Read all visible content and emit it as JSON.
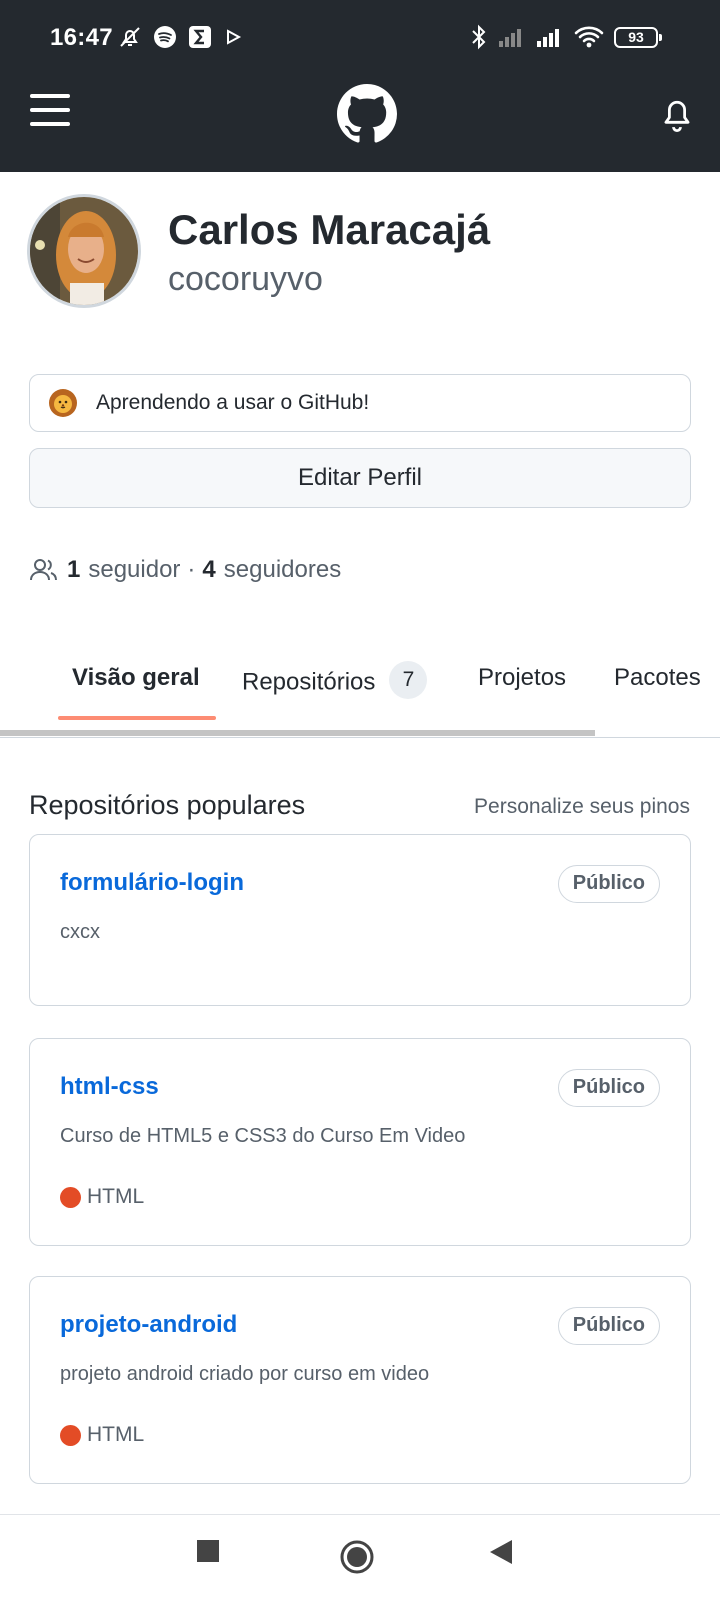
{
  "status_bar": {
    "time": "16:47",
    "battery": "93",
    "left_icons": [
      "mute-bell-icon",
      "spotify-icon",
      "sigma-app-icon",
      "play-store-icon"
    ],
    "right_icons": [
      "bluetooth-icon",
      "signal-icon",
      "signal-icon",
      "wifi-icon",
      "battery-icon"
    ]
  },
  "header": {
    "icons": [
      "menu-icon",
      "github-logo-icon",
      "bell-icon"
    ],
    "background": "#24292f"
  },
  "profile": {
    "display_name": "Carlos Maracajá",
    "username": "cocoruyvo",
    "status_emoji": "lion-emoji-icon",
    "status_text": "Aprendendo a usar o GitHub!",
    "edit_button": "Editar Perfil",
    "followers_count": "1",
    "followers_label": "seguidor",
    "separator": "·",
    "following_count": "4",
    "following_label": "seguidores"
  },
  "tabs": [
    {
      "label": "Visão geral",
      "active": true
    },
    {
      "label": "Repositórios",
      "count": "7"
    },
    {
      "label": "Projetos"
    },
    {
      "label": "Pacotes"
    }
  ],
  "pinned": {
    "title": "Repositórios populares",
    "customize": "Personalize seus pinos",
    "repos": [
      {
        "name": "formulário-login",
        "visibility": "Público",
        "description": "cxcx"
      },
      {
        "name": "html-css",
        "visibility": "Público",
        "description": "Curso de HTML5 e CSS3 do Curso Em Video",
        "language": "HTML",
        "language_color": "#e34c26"
      },
      {
        "name": "projeto-android",
        "visibility": "Público",
        "description": "projeto android criado por curso em video",
        "language": "HTML",
        "language_color": "#e34c26"
      }
    ]
  },
  "colors": {
    "link": "#0969da",
    "tab_accent": "#fd8c73",
    "text": "#24292f",
    "muted": "#57606a"
  },
  "nav_bar": {
    "icons": [
      "recents-square-icon",
      "home-circle-icon",
      "back-triangle-icon"
    ]
  }
}
